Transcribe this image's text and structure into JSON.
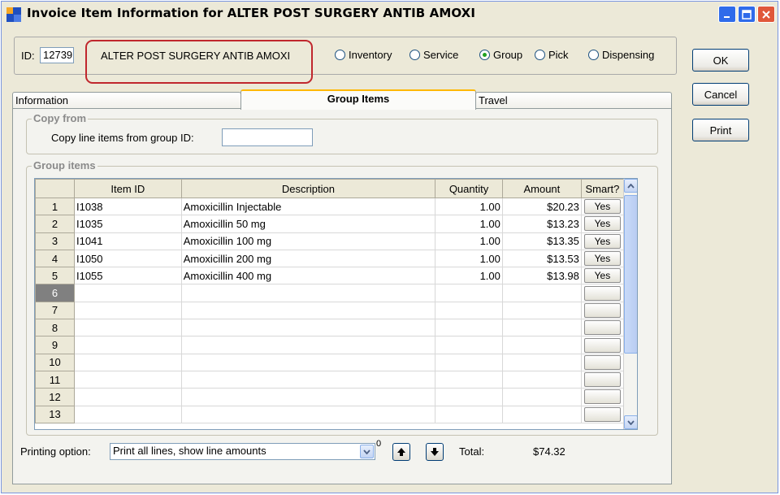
{
  "window": {
    "title": "Invoice Item Information for ALTER POST SURGERY ANTIB AMOXI",
    "accent": "#0a246a",
    "highlight_color": "#c0272d"
  },
  "header": {
    "id_label": "ID:",
    "id_value": "12739",
    "name_value": "ALTER POST SURGERY ANTIB AMOXI",
    "item_types": [
      {
        "label": "Inventory",
        "selected": false
      },
      {
        "label": "Service",
        "selected": false
      },
      {
        "label": "Group",
        "selected": true
      },
      {
        "label": "Pick",
        "selected": false
      },
      {
        "label": "Dispensing",
        "selected": false
      }
    ]
  },
  "buttons": {
    "ok": "OK",
    "cancel": "Cancel",
    "print": "Print"
  },
  "tabs": [
    {
      "label": "Information",
      "active": false
    },
    {
      "label": "Group Items",
      "active": true
    },
    {
      "label": "Travel",
      "active": false
    }
  ],
  "copy_from": {
    "title": "Copy from",
    "label": "Copy line items from group ID:",
    "value": ""
  },
  "group_items": {
    "title": "Group  items",
    "columns": [
      "",
      "Item ID",
      "Description",
      "Quantity",
      "Amount",
      "Smart?"
    ],
    "rows": [
      {
        "n": "1",
        "id": "I1038",
        "desc": "Amoxicillin Injectable",
        "qty": "1.00",
        "amount": "$20.23",
        "smart": "Yes"
      },
      {
        "n": "2",
        "id": "I1035",
        "desc": "Amoxicillin  50 mg",
        "qty": "1.00",
        "amount": "$13.23",
        "smart": "Yes"
      },
      {
        "n": "3",
        "id": "I1041",
        "desc": "Amoxicillin 100 mg",
        "qty": "1.00",
        "amount": "$13.35",
        "smart": "Yes"
      },
      {
        "n": "4",
        "id": "I1050",
        "desc": "Amoxicillin 200 mg",
        "qty": "1.00",
        "amount": "$13.53",
        "smart": "Yes"
      },
      {
        "n": "5",
        "id": "I1055",
        "desc": "Amoxicillin 400 mg",
        "qty": "1.00",
        "amount": "$13.98",
        "smart": "Yes"
      },
      {
        "n": "6",
        "id": "",
        "desc": "",
        "qty": "",
        "amount": "",
        "smart": ""
      },
      {
        "n": "7",
        "id": "",
        "desc": "",
        "qty": "",
        "amount": "",
        "smart": ""
      },
      {
        "n": "8",
        "id": "",
        "desc": "",
        "qty": "",
        "amount": "",
        "smart": ""
      },
      {
        "n": "9",
        "id": "",
        "desc": "",
        "qty": "",
        "amount": "",
        "smart": ""
      },
      {
        "n": "10",
        "id": "",
        "desc": "",
        "qty": "",
        "amount": "",
        "smart": ""
      },
      {
        "n": "11",
        "id": "",
        "desc": "",
        "qty": "",
        "amount": "",
        "smart": ""
      },
      {
        "n": "12",
        "id": "",
        "desc": "",
        "qty": "",
        "amount": "",
        "smart": ""
      },
      {
        "n": "13",
        "id": "",
        "desc": "",
        "qty": "",
        "amount": "",
        "smart": ""
      }
    ],
    "current_row": "6"
  },
  "footer": {
    "printing_label": "Printing option:",
    "printing_value": "Print all lines, show line amounts",
    "superscript": "0",
    "total_label": "Total:",
    "total_value": "$74.32"
  },
  "icons": [
    "app-icon",
    "minimize-icon",
    "maximize-icon",
    "close-icon",
    "chevron-down-icon",
    "arrow-up-icon",
    "arrow-down-icon"
  ]
}
